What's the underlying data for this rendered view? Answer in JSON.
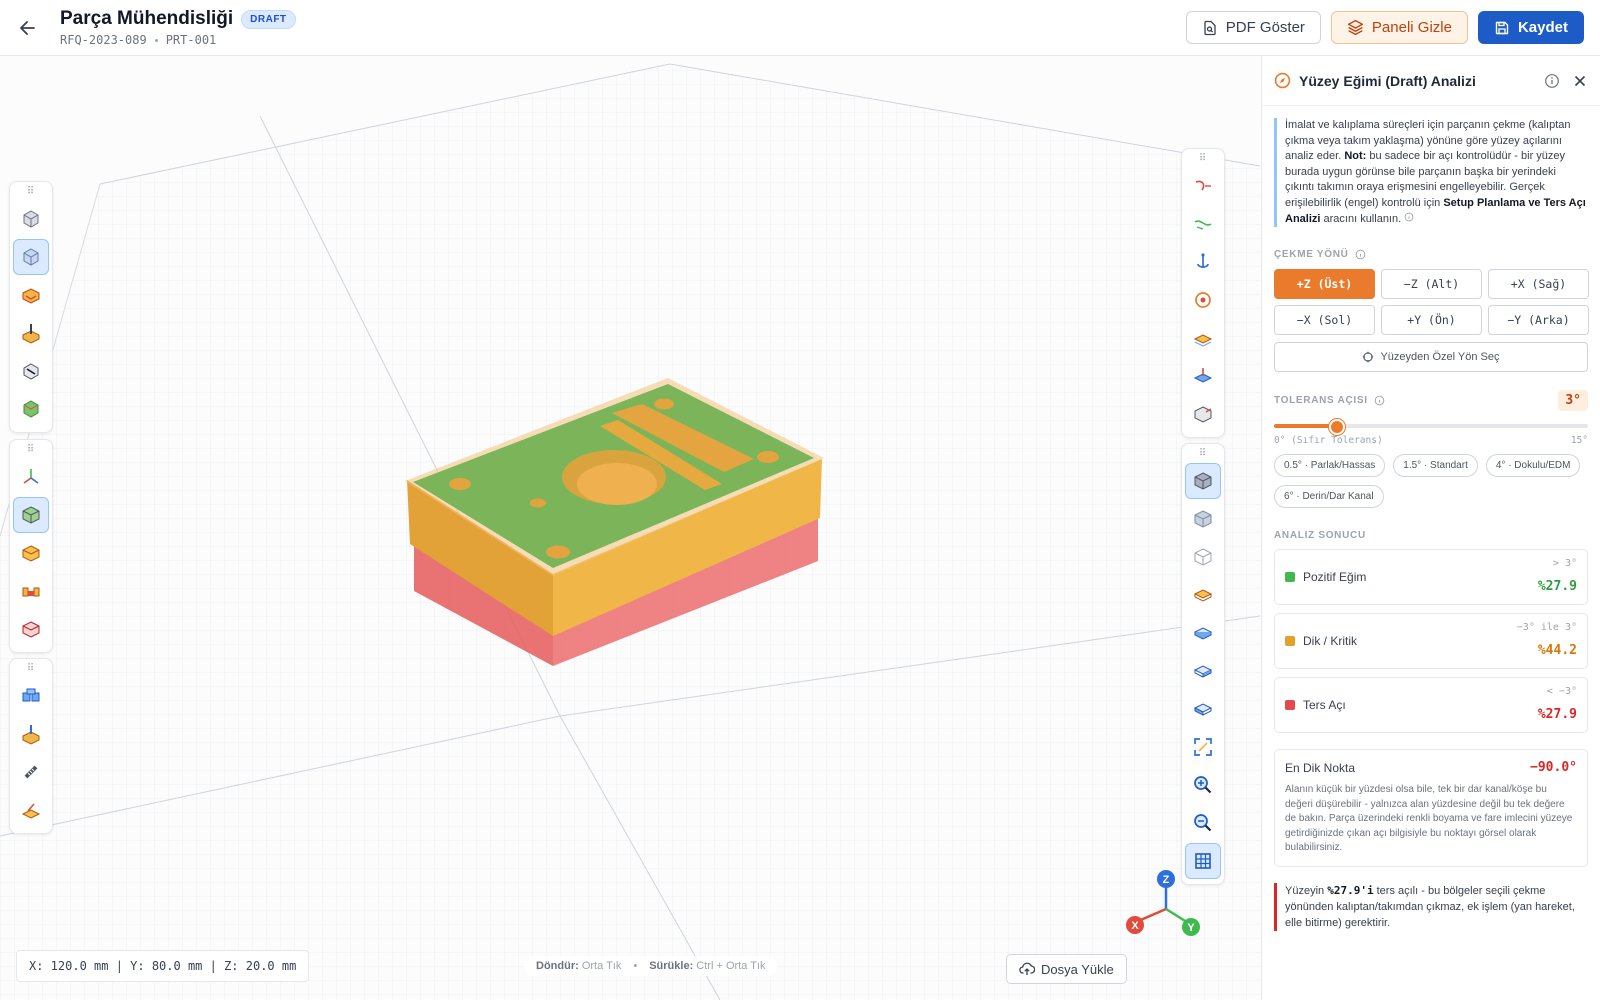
{
  "header": {
    "title": "Parça Mühendisliği",
    "badge": "DRAFT",
    "rfq": "RFQ-2023-089",
    "part": "PRT-001",
    "pdf_label": "PDF Göster",
    "hide_label": "Paneli Gizle",
    "save_label": "Kaydet"
  },
  "viewport": {
    "coords": "X: 120.0 mm | Y: 80.0 mm | Z: 20.0 mm",
    "hint_rotate_key": "Döndür:",
    "hint_rotate_val": "Orta Tık",
    "hint_drag_key": "Sürükle:",
    "hint_drag_val": "Ctrl + Orta Tık",
    "upload_label": "Dosya Yükle",
    "axis_x": "X",
    "axis_y": "Y",
    "axis_z": "Z"
  },
  "panel": {
    "title": "Yüzey Eğimi (Draft) Analizi",
    "desc_1": "İmalat ve kalıplama süreçleri için parçanın çekme (kalıptan çıkma veya takım yaklaşma) yönüne göre yüzey açılarını analiz eder. ",
    "desc_not": "Not:",
    "desc_2": " bu sadece bir açı kontrolüdür - bir yüzey burada uygun görünse bile parçanın başka bir yerindeki çıkıntı takımın oraya erişmesini engelleyebilir. Gerçek erişilebilirlik (engel) kontrolü için ",
    "desc_tool": "Setup Planlama ve Ters Açı Analizi",
    "desc_3": " aracını kullanın.",
    "pull_title": "ÇEKME YÖNÜ",
    "directions": [
      "+Z (Üst)",
      "−Z (Alt)",
      "+X (Sağ)",
      "−X (Sol)",
      "+Y (Ön)",
      "−Y (Arka)"
    ],
    "custom_label": "Yüzeyden Özel Yön Seç",
    "tol_title": "TOLERANS AÇISI",
    "tol_value": "3°",
    "tol_min": "0° (Sıfır Tolerans)",
    "tol_max": "15°",
    "tol_fraction": 0.2,
    "presets": [
      "0.5° · Parlak/Hassas",
      "1.5° · Standart",
      "4° · Dokulu/EDM",
      "6° · Derin/Dar Kanal"
    ],
    "result_title": "ANALIZ SONUCU",
    "results": [
      {
        "name": "Pozitif Eğim",
        "range": "> 3°",
        "pct": "%27.9",
        "color": "#3fb950"
      },
      {
        "name": "Dik / Kritik",
        "range": "−3° ile 3°",
        "pct": "%44.2",
        "color": "#e5a02a"
      },
      {
        "name": "Ters Açı",
        "range": "< −3°",
        "pct": "%27.9",
        "color": "#e5484d"
      }
    ],
    "peak_label": "En Dik Nokta",
    "peak_value": "−90.0°",
    "peak_text": "Alanın küçük bir yüzdesi olsa bile, tek bir dar kanal/köşe bu değeri düşürebilir - yalnızca alan yüzdesine değil bu tek değere de bakın. Parça üzerindeki renkli boyama ve fare imlecini yüzeye getirdiğinizde çıkan açı bilgisiyle bu noktayı görsel olarak bulabilirsiniz.",
    "warn_1": "Yüzeyin ",
    "warn_pct": "%27.9'i",
    "warn_2": " ters açılı - bu bölgeler seçili çekme yönünden kalıptan/takımdan çıkmaz, ek işlem (yan hareket, elle bitirme) gerektirir."
  }
}
